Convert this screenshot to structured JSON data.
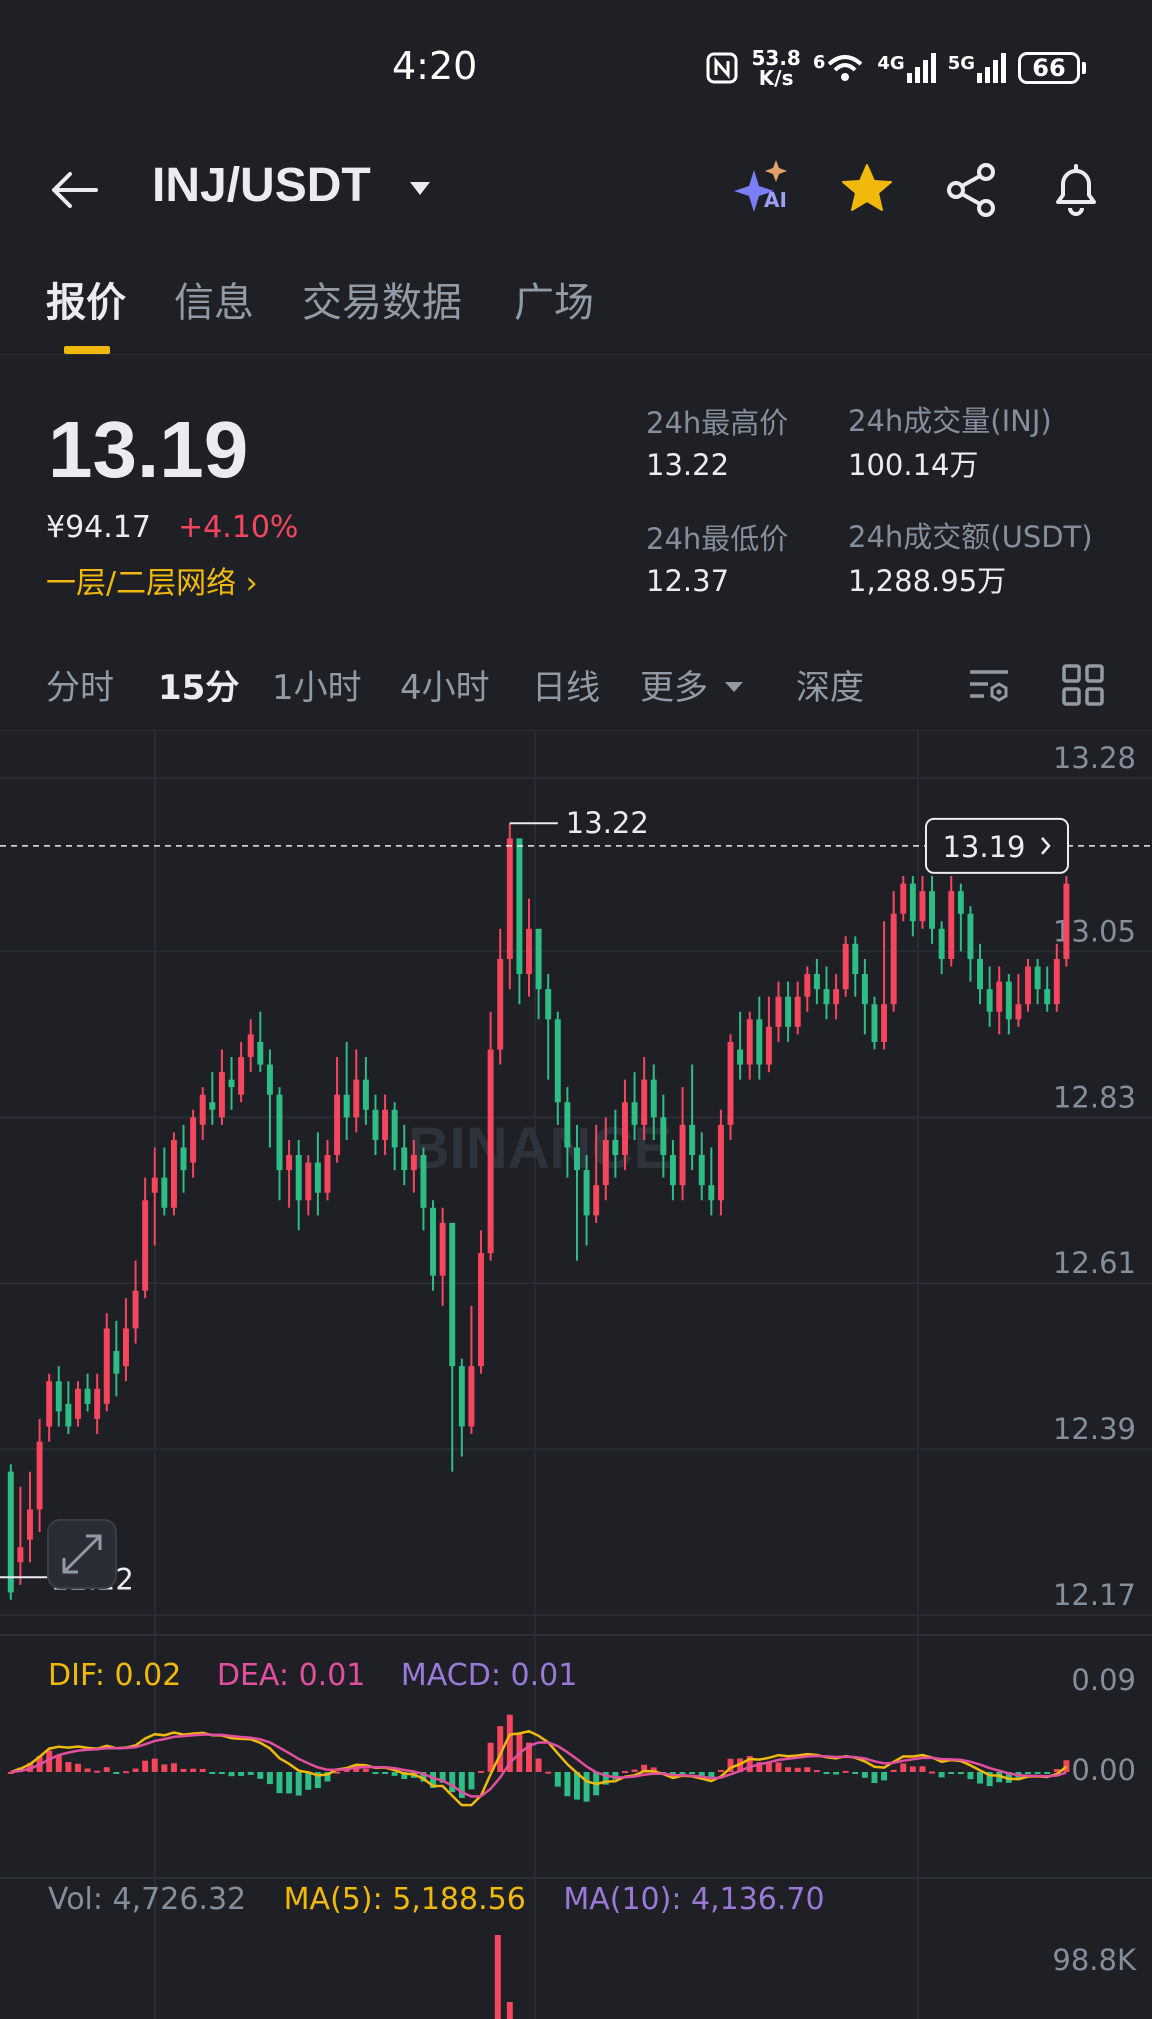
{
  "status_bar": {
    "time": "4:20",
    "network_speed_value": "53.8",
    "network_speed_unit": "K/s",
    "wifi_label": "6",
    "signal1_label": "4G",
    "signal2_label": "5G",
    "battery": "66"
  },
  "header": {
    "pair": "INJ/USDT",
    "ai_label": "AI"
  },
  "tabs": [
    {
      "label": "报价",
      "active": true
    },
    {
      "label": "信息",
      "active": false
    },
    {
      "label": "交易数据",
      "active": false
    },
    {
      "label": "广场",
      "active": false
    }
  ],
  "price": {
    "last": "13.19",
    "cny": "¥94.17",
    "change": "+4.10%",
    "network_link": "一层/二层网络 ›"
  },
  "stats": {
    "high_label": "24h最高价",
    "high": "13.22",
    "low_label": "24h最低价",
    "low": "12.37",
    "vol_label": "24h成交量(INJ)",
    "vol": "100.14万",
    "turnover_label": "24h成交额(USDT)",
    "turnover": "1,288.95万"
  },
  "intervals": [
    {
      "label": "分时",
      "active": false
    },
    {
      "label": "15分",
      "active": true
    },
    {
      "label": "1小时",
      "active": false
    },
    {
      "label": "4小时",
      "active": false
    },
    {
      "label": "日线",
      "active": false
    },
    {
      "label": "更多",
      "active": false
    },
    {
      "label": "深度",
      "active": false
    }
  ],
  "colors": {
    "up": "#f6465d",
    "down": "#2ebd85",
    "accent": "#f0b90b",
    "dif": "#f0b90b",
    "dea": "#e24fa0",
    "macd": "#9a7ad6"
  },
  "indicators": {
    "dif": "DIF: 0.02",
    "dea": "DEA: 0.01",
    "macd": "MACD: 0.01"
  },
  "volume": {
    "vol": "Vol: 4,726.32",
    "ma5": "MA(5): 5,188.56",
    "ma10": "MA(10): 4,136.70",
    "axis_top": "98.8K"
  },
  "chart_data": {
    "type": "candlestick",
    "y_ticks": [
      "13.28",
      "13.05",
      "12.83",
      "12.61",
      "12.39",
      "12.17"
    ],
    "ylim": [
      12.17,
      13.28
    ],
    "high_marker": "13.22",
    "low_marker": "12.22",
    "current_price_tag": "13.19",
    "macd_ticks": [
      "0.09",
      "0.00"
    ],
    "watermark": "BINANCE",
    "candles": [
      [
        12.36,
        12.2,
        12.37,
        12.19
      ],
      [
        12.24,
        12.26,
        12.34,
        12.21
      ],
      [
        12.27,
        12.31,
        12.36,
        12.24
      ],
      [
        12.31,
        12.4,
        12.43,
        12.28
      ],
      [
        12.42,
        12.48,
        12.49,
        12.4
      ],
      [
        12.48,
        12.44,
        12.5,
        12.42
      ],
      [
        12.45,
        12.42,
        12.48,
        12.41
      ],
      [
        12.43,
        12.47,
        12.48,
        12.42
      ],
      [
        12.47,
        12.45,
        12.49,
        12.44
      ],
      [
        12.43,
        12.47,
        12.49,
        12.41
      ],
      [
        12.45,
        12.55,
        12.57,
        12.44
      ],
      [
        12.52,
        12.49,
        12.56,
        12.46
      ],
      [
        12.5,
        12.55,
        12.59,
        12.48
      ],
      [
        12.55,
        12.6,
        12.64,
        12.53
      ],
      [
        12.6,
        12.72,
        12.75,
        12.59
      ],
      [
        12.73,
        12.75,
        12.79,
        12.66
      ],
      [
        12.75,
        12.71,
        12.79,
        12.7
      ],
      [
        12.71,
        12.8,
        12.81,
        12.7
      ],
      [
        12.79,
        12.76,
        12.82,
        12.73
      ],
      [
        12.77,
        12.83,
        12.84,
        12.75
      ],
      [
        12.82,
        12.86,
        12.87,
        12.8
      ],
      [
        12.85,
        12.84,
        12.89,
        12.82
      ],
      [
        12.83,
        12.89,
        12.92,
        12.82
      ],
      [
        12.88,
        12.87,
        12.91,
        12.84
      ],
      [
        12.86,
        12.91,
        12.93,
        12.85
      ],
      [
        12.91,
        12.94,
        12.96,
        12.89
      ],
      [
        12.93,
        12.9,
        12.97,
        12.89
      ],
      [
        12.9,
        12.86,
        12.92,
        12.79
      ],
      [
        12.86,
        12.76,
        12.87,
        12.72
      ],
      [
        12.76,
        12.78,
        12.8,
        12.71
      ],
      [
        12.78,
        12.72,
        12.8,
        12.68
      ],
      [
        12.72,
        12.77,
        12.78,
        12.7
      ],
      [
        12.77,
        12.73,
        12.81,
        12.7
      ],
      [
        12.73,
        12.78,
        12.8,
        12.72
      ],
      [
        12.78,
        12.86,
        12.91,
        12.77
      ],
      [
        12.86,
        12.83,
        12.93,
        12.8
      ],
      [
        12.83,
        12.88,
        12.92,
        12.81
      ],
      [
        12.88,
        12.84,
        12.91,
        12.82
      ],
      [
        12.84,
        12.8,
        12.86,
        12.78
      ],
      [
        12.8,
        12.84,
        12.86,
        12.78
      ],
      [
        12.84,
        12.79,
        12.85,
        12.76
      ],
      [
        12.79,
        12.76,
        12.82,
        12.74
      ],
      [
        12.76,
        12.78,
        12.8,
        12.73
      ],
      [
        12.78,
        12.71,
        12.79,
        12.68
      ],
      [
        12.71,
        12.62,
        12.72,
        12.6
      ],
      [
        12.62,
        12.69,
        12.71,
        12.58
      ],
      [
        12.69,
        12.5,
        12.69,
        12.36
      ],
      [
        12.5,
        12.42,
        12.51,
        12.38
      ],
      [
        12.42,
        12.5,
        12.58,
        12.41
      ],
      [
        12.5,
        12.65,
        12.68,
        12.49
      ],
      [
        12.65,
        12.92,
        12.97,
        12.64
      ],
      [
        12.92,
        13.04,
        13.08,
        12.9
      ],
      [
        13.04,
        13.2,
        13.22,
        13.0
      ],
      [
        13.2,
        13.02,
        13.1,
        12.98
      ],
      [
        13.02,
        13.08,
        13.12,
        12.99
      ],
      [
        13.08,
        13.0,
        13.08,
        12.96
      ],
      [
        13.0,
        12.96,
        13.02,
        12.88
      ],
      [
        12.96,
        12.85,
        12.97,
        12.82
      ],
      [
        12.85,
        12.79,
        12.87,
        12.75
      ],
      [
        12.79,
        12.76,
        12.82,
        12.64
      ],
      [
        12.76,
        12.7,
        12.78,
        12.66
      ],
      [
        12.7,
        12.74,
        12.82,
        12.69
      ],
      [
        12.74,
        12.8,
        12.83,
        12.72
      ],
      [
        12.8,
        12.78,
        12.84,
        12.75
      ],
      [
        12.78,
        12.85,
        12.88,
        12.76
      ],
      [
        12.85,
        12.82,
        12.89,
        12.8
      ],
      [
        12.82,
        12.88,
        12.91,
        12.8
      ],
      [
        12.88,
        12.83,
        12.9,
        12.8
      ],
      [
        12.83,
        12.78,
        12.86,
        12.75
      ],
      [
        12.78,
        12.74,
        12.8,
        12.72
      ],
      [
        12.74,
        12.82,
        12.87,
        12.72
      ],
      [
        12.82,
        12.78,
        12.9,
        12.76
      ],
      [
        12.78,
        12.74,
        12.81,
        12.72
      ],
      [
        12.74,
        12.72,
        12.79,
        12.7
      ],
      [
        12.72,
        12.82,
        12.84,
        12.7
      ],
      [
        12.82,
        12.93,
        12.94,
        12.8
      ],
      [
        12.92,
        12.9,
        12.97,
        12.88
      ],
      [
        12.9,
        12.96,
        12.97,
        12.88
      ],
      [
        12.96,
        12.9,
        12.99,
        12.88
      ],
      [
        12.9,
        12.95,
        12.99,
        12.89
      ],
      [
        12.95,
        12.99,
        13.01,
        12.93
      ],
      [
        12.99,
        12.95,
        13.01,
        12.93
      ],
      [
        12.95,
        12.99,
        13.01,
        12.94
      ],
      [
        12.99,
        13.02,
        13.03,
        12.97
      ],
      [
        13.02,
        13.0,
        13.04,
        12.98
      ],
      [
        13.0,
        12.98,
        13.03,
        12.96
      ],
      [
        12.98,
        13.0,
        13.02,
        12.96
      ],
      [
        13.0,
        13.06,
        13.07,
        12.99
      ],
      [
        13.06,
        13.02,
        13.07,
        12.99
      ],
      [
        13.02,
        12.98,
        13.04,
        12.94
      ],
      [
        12.98,
        12.93,
        12.99,
        12.92
      ],
      [
        12.93,
        12.98,
        13.09,
        12.92
      ],
      [
        12.98,
        13.1,
        13.13,
        12.97
      ],
      [
        13.1,
        13.14,
        13.15,
        13.09
      ],
      [
        13.14,
        13.09,
        13.15,
        13.07
      ],
      [
        13.09,
        13.13,
        13.15,
        13.08
      ],
      [
        13.13,
        13.08,
        13.15,
        13.06
      ],
      [
        13.08,
        13.04,
        13.09,
        13.02
      ],
      [
        13.04,
        13.13,
        13.15,
        13.03
      ],
      [
        13.13,
        13.1,
        13.14,
        13.05
      ],
      [
        13.1,
        13.04,
        13.11,
        13.01
      ],
      [
        13.04,
        13.0,
        13.06,
        12.98
      ],
      [
        13.0,
        12.97,
        13.03,
        12.95
      ],
      [
        12.97,
        13.01,
        13.03,
        12.94
      ],
      [
        13.01,
        12.96,
        13.02,
        12.94
      ],
      [
        12.96,
        12.98,
        13.02,
        12.95
      ],
      [
        12.98,
        13.03,
        13.04,
        12.97
      ],
      [
        13.03,
        13.0,
        13.04,
        12.98
      ],
      [
        13.0,
        12.98,
        13.03,
        12.97
      ],
      [
        12.98,
        13.04,
        13.06,
        12.97
      ],
      [
        13.04,
        13.14,
        13.15,
        13.03
      ]
    ]
  }
}
